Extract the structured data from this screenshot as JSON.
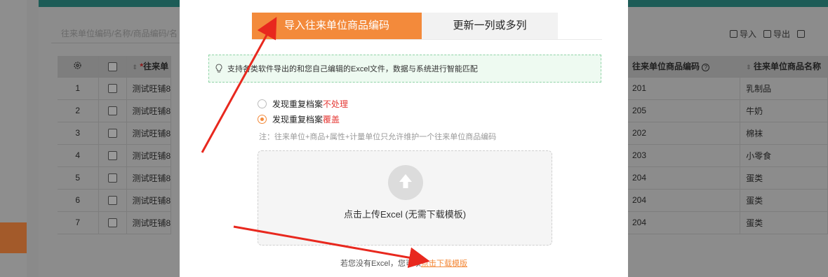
{
  "background": {
    "search_placeholder": "往来单位编码/名称/商品编码/名",
    "toolbar": [
      {
        "label": "导入",
        "icon": "import-icon"
      },
      {
        "label": "导出",
        "icon": "export-icon"
      },
      {
        "label": "",
        "icon": "delete-icon"
      }
    ],
    "table": {
      "required_mark": "*",
      "name_header": "往来单",
      "rows": [
        {
          "idx": "1",
          "name": "测试旺铺8"
        },
        {
          "idx": "2",
          "name": "测试旺铺8"
        },
        {
          "idx": "3",
          "name": "测试旺铺8"
        },
        {
          "idx": "4",
          "name": "测试旺铺8"
        },
        {
          "idx": "5",
          "name": "测试旺铺8"
        },
        {
          "idx": "6",
          "name": "测试旺铺8"
        },
        {
          "idx": "7",
          "name": "测试旺铺8"
        }
      ]
    },
    "right_table": {
      "code_header": "往来单位商品编码",
      "name_header": "往来单位商品名称",
      "rows": [
        {
          "code": "201",
          "name": "乳制品"
        },
        {
          "code": "205",
          "name": "牛奶"
        },
        {
          "code": "202",
          "name": "棉袜"
        },
        {
          "code": "203",
          "name": "小零食"
        },
        {
          "code": "204",
          "name": "蛋类"
        },
        {
          "code": "204",
          "name": "蛋类"
        },
        {
          "code": "204",
          "name": "蛋类"
        }
      ]
    }
  },
  "modal": {
    "tabs": [
      {
        "label": "导入往来单位商品编码",
        "active": true
      },
      {
        "label": "更新一列或多列",
        "active": false
      }
    ],
    "tip": "支持各类软件导出的和您自己编辑的Excel文件，数据与系统进行智能匹配",
    "options": [
      {
        "prefix": "发现重复档案",
        "highlight": "不处理",
        "checked": false
      },
      {
        "prefix": "发现重复档案",
        "highlight": "覆盖",
        "checked": true
      }
    ],
    "note": "注：往来单位+商品+属性+计量单位只允许维护一个往来单位商品编码",
    "upload_text": "点击上传Excel (无需下载模板)",
    "footer_prefix": "若您没有Excel，您可以",
    "footer_link": "点击下载模版"
  },
  "colors": {
    "accent": "#f38a3b",
    "tip_border": "#8fd3a6",
    "tip_bg": "#eefaf1",
    "highlight_red": "#e53935",
    "arrow_red": "#e8281e"
  }
}
